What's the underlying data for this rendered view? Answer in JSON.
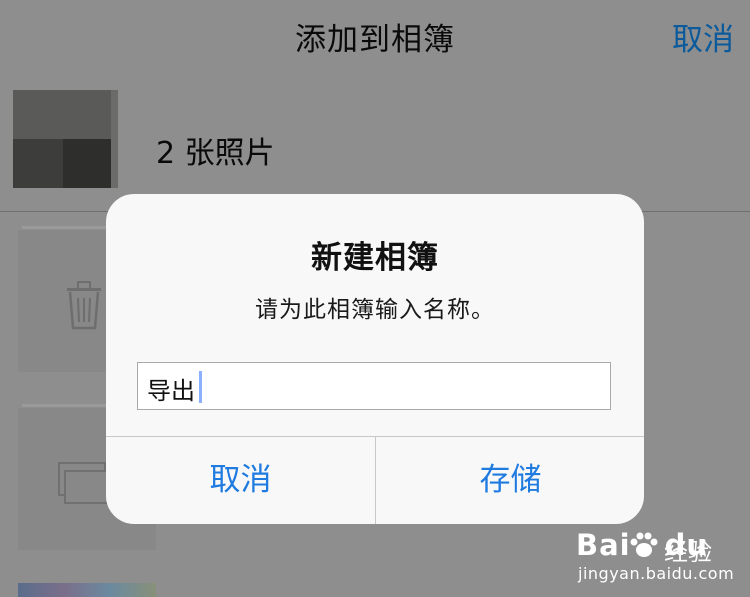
{
  "nav": {
    "title": "添加到相簿",
    "cancel": "取消"
  },
  "selection_row": {
    "label": "2 张照片"
  },
  "alert": {
    "title": "新建相簿",
    "message": "请为此相簿输入名称。",
    "input_value": "导出",
    "cancel_label": "取消",
    "save_label": "存储"
  },
  "watermark": {
    "logo_left": "Bai",
    "logo_right": "du",
    "label": "经验",
    "url": "jingyan.baidu.com"
  },
  "colors": {
    "accent": "#1f7be0",
    "dim_background": "#8e8e8e",
    "alert_background": "#f8f8f8"
  },
  "icons": [
    "trash-icon",
    "album-placeholder-icon",
    "baidu-paw-icon"
  ]
}
